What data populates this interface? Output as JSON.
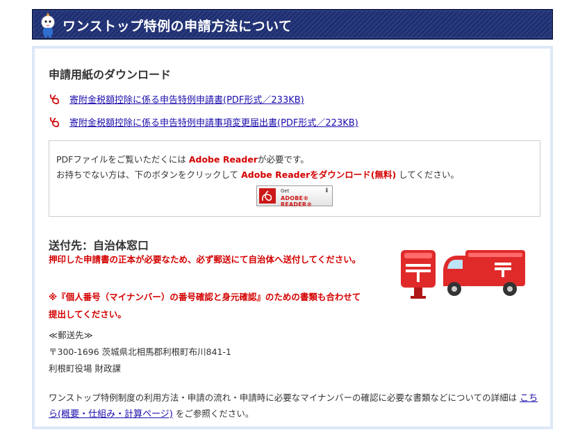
{
  "header": {
    "title": "ワンストップ特例の申請方法について"
  },
  "download": {
    "heading": "申請用紙のダウンロード",
    "links": [
      {
        "label": "寄附金税額控除に係る申告特例申請書(PDF形式／233KB)"
      },
      {
        "label": "寄附金税額控除に係る申告特例申請事項変更届出書(PDF形式／223KB)"
      }
    ]
  },
  "pdf_notice": {
    "line1_pre": "PDFファイルをご覧いただくには",
    "line1_em": "Adobe Reader",
    "line1_post": "が必要です。",
    "line2_pre": "お持ちでない方は、下のボタンをクリックして",
    "line2_em": "Adobe Readerをダウンロード(無料)",
    "line2_post": "してください。",
    "button": {
      "get": "Get",
      "name": "ADOBE® READER®"
    }
  },
  "sendto": {
    "heading": "送付先：自治体窓口",
    "note1": "押印した申請書の正本が必要なため、必ず郵送にて自治体へ送付してください。",
    "note2": "※『個人番号（マイナンバー）の番号確認と身元確認』のための書類も合わせて提出してください。",
    "address_label": "≪郵送先≫",
    "address": "〒300-1696 茨城県北相馬郡利根町布川841-1",
    "office": "利根町役場 財政課"
  },
  "footer": {
    "text_pre": "ワンストップ特例制度の利用方法・申請の流れ・申請時に必要なマイナンバーの確認に必要な書類などについての詳細は",
    "link_label": "こちら(概要・仕組み・計算ページ)",
    "text_post": "をご参照ください。"
  },
  "colors": {
    "header_bg": "#1d2e72",
    "panel_border": "#dde8f7",
    "accent_red": "#d40000",
    "link": "#1a0dab"
  }
}
